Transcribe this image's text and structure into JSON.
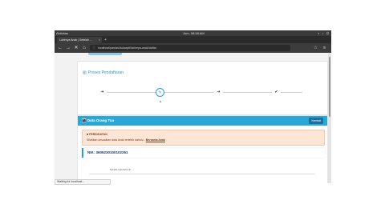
{
  "os": {
    "left": "Aktivitas",
    "app": "Firefox Web Browser",
    "center": "Jum, 08:58 AM",
    "right_icons": "◐ ♪ ⏻"
  },
  "browser": {
    "tab_title": "Lahirnya Anak | Setelah …",
    "tab_close": "×",
    "new_tab": "+",
    "back_icon": "←",
    "forward_icon": "→",
    "stop_icon": "✕",
    "home_icon": "⌂",
    "url": "localhost/pantas/dukcapil/lahirnya-anak/daftar",
    "nav_right": "☆ ≡"
  },
  "page": {
    "section_title": "Proses Pendaftaran",
    "steps": [
      "➜",
      "✎",
      "➜",
      "✔"
    ],
    "data_header": "Data Orang Tua",
    "data_button": "Kembali",
    "alert_title": "PERINGATAN",
    "alert_body": "Silahkan sesuaikan data Anak terlebih dahulu",
    "alert_link": "Bersama Anak",
    "nik": "NIK: 3606230100102261",
    "field_label": "NAMA LENGKAP"
  },
  "status": {
    "text": "Waiting for localhost..."
  }
}
